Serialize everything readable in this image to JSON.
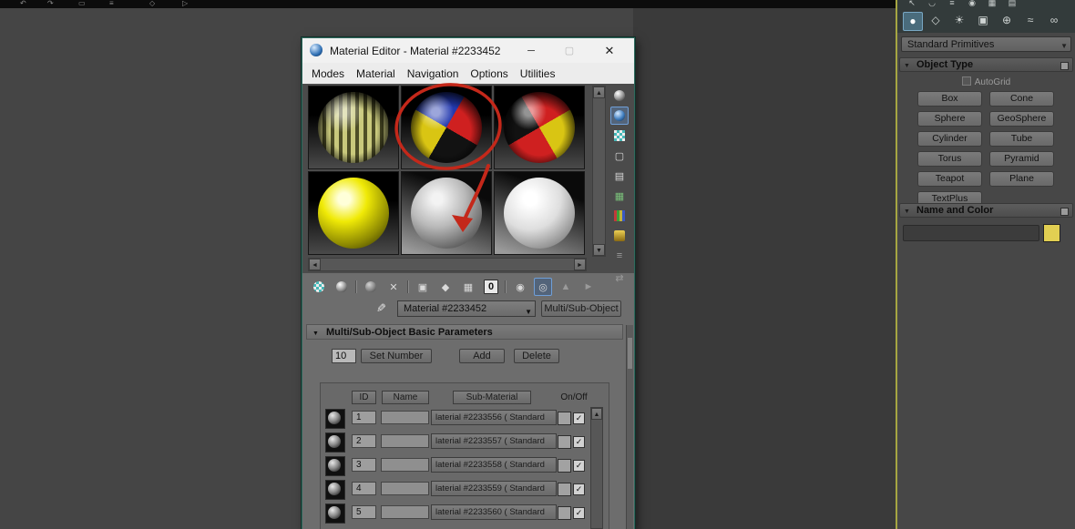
{
  "glyphs": {
    "minimize": "─",
    "maximize": "▢",
    "close": "✕",
    "arrow_down": "▼",
    "arrow_up": "▲",
    "arrow_left": "◄",
    "arrow_right": "►",
    "check": "✓",
    "eyedropper": "✎",
    "compare": "⇄",
    "rollout_open": "▼"
  },
  "icon_glyphs": {
    "square": "▢",
    "video": "▤",
    "grid": "▦",
    "menu": "≡",
    "reset": "✕",
    "copy": "▣",
    "unique": "◆",
    "library": "▦",
    "parent": "▲",
    "forward": "►",
    "show_end": "◎",
    "viewport": "◉"
  },
  "top_bar": {
    "glyphs": [
      "↶",
      "↷",
      "▭",
      "≡",
      "◇",
      "▷"
    ]
  },
  "window": {
    "title": "Material Editor - Material #2233452",
    "menus": [
      "Modes",
      "Material",
      "Navigation",
      "Options",
      "Utilities"
    ],
    "material_id_channel": "0",
    "material_name": "Material #2233452",
    "type_button": "Multi/Sub-Object",
    "rollout": "Multi/Sub-Object Basic Parameters",
    "params": {
      "count": "10",
      "set_number": "Set Number",
      "add": "Add",
      "delete": "Delete"
    },
    "table": {
      "headers": {
        "id": "ID",
        "name": "Name",
        "sub": "Sub-Material",
        "onoff": "On/Off"
      },
      "rows": [
        {
          "id": "1",
          "name": "",
          "sub": "laterial #2233556  ( Standard"
        },
        {
          "id": "2",
          "name": "",
          "sub": "laterial #2233557  ( Standard"
        },
        {
          "id": "3",
          "name": "",
          "sub": "laterial #2233558  ( Standard"
        },
        {
          "id": "4",
          "name": "",
          "sub": "laterial #2233559  ( Standard"
        },
        {
          "id": "5",
          "name": "",
          "sub": "laterial #2233560  ( Standard"
        }
      ]
    }
  },
  "command_panel": {
    "primitives_dropdown": "Standard Primitives",
    "tab_icons_row1": [
      "↖",
      "◡",
      "≡",
      "◉",
      "▦",
      "▤"
    ],
    "tab_icons_row2": [
      "●",
      "◇",
      "☀",
      "▣",
      "⊕",
      "≈",
      "∞"
    ],
    "object_type": {
      "title": "Object Type",
      "autogrid": "AutoGrid",
      "buttons": [
        "Box",
        "Cone",
        "Sphere",
        "GeoSphere",
        "Cylinder",
        "Tube",
        "Torus",
        "Pyramid",
        "Teapot",
        "Plane",
        "TextPlus"
      ]
    },
    "name_and_color": {
      "title": "Name and Color",
      "name_value": ""
    }
  },
  "colors": {
    "annotation_red": "#c4281a",
    "active_border_yellow": "#a6a642",
    "name_color_swatch": "#e2cf52",
    "highlight_blue": "#6f9fd8"
  }
}
